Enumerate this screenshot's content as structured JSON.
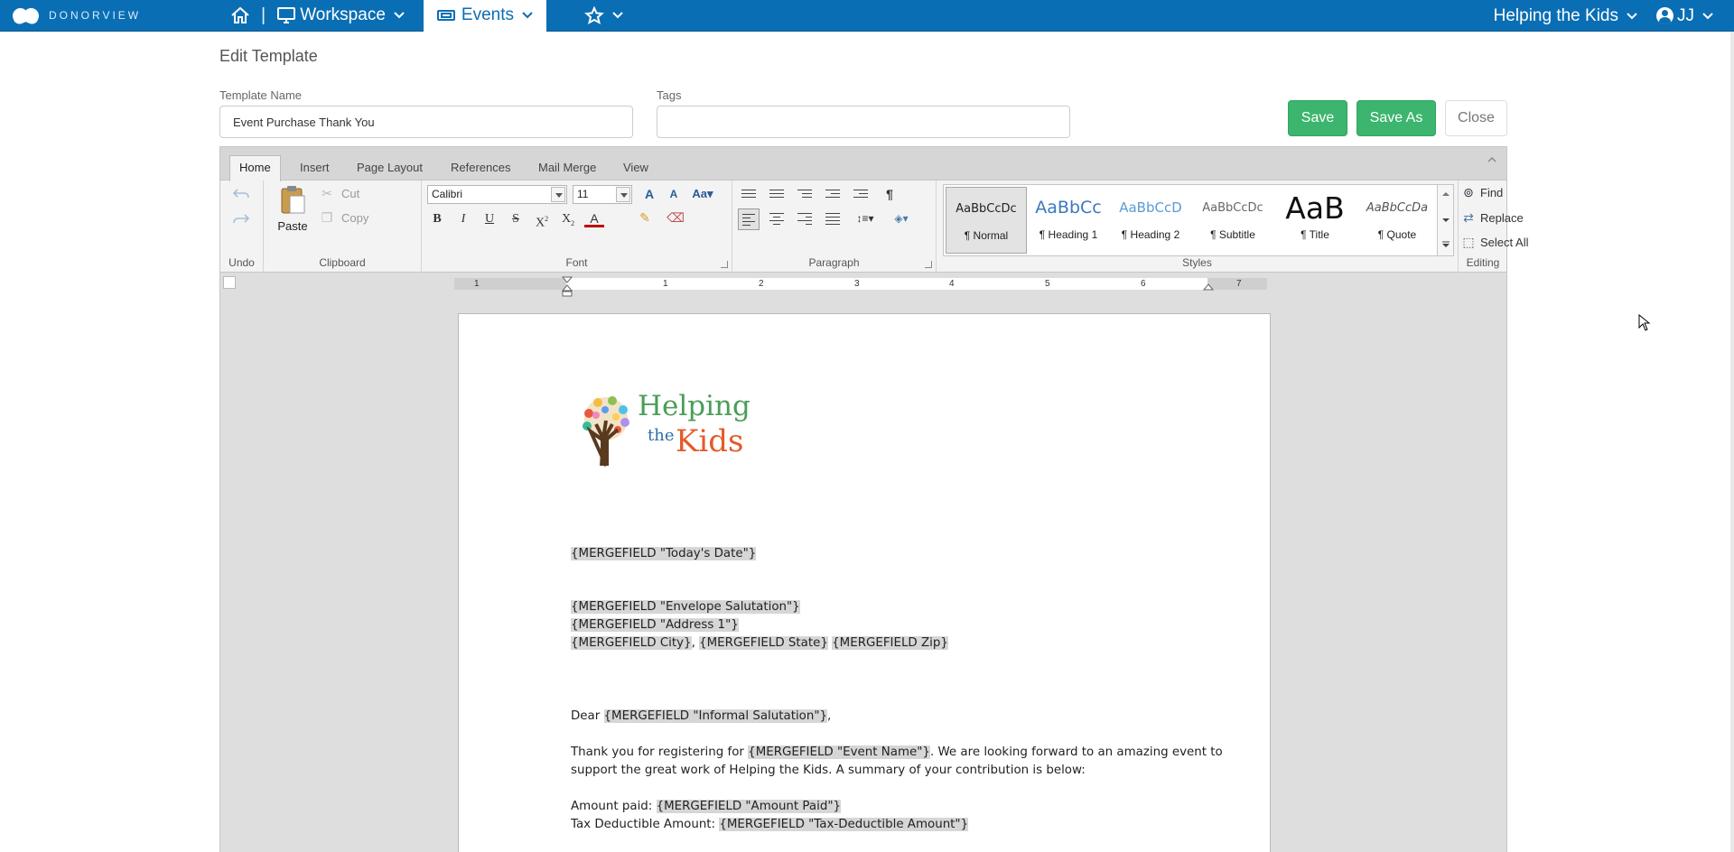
{
  "nav": {
    "brand": "DONORVIEW",
    "workspace": "Workspace",
    "events": "Events",
    "org": "Helping the Kids",
    "user": "JJ"
  },
  "editor": {
    "title": "Edit Template",
    "template_name_label": "Template Name",
    "template_name_value": "Event Purchase Thank You",
    "tags_label": "Tags",
    "tags_value": "",
    "save": "Save",
    "save_as": "Save As",
    "close": "Close"
  },
  "ribbon": {
    "tabs": [
      "Home",
      "Insert",
      "Page Layout",
      "References",
      "Mail Merge",
      "View"
    ],
    "groups": {
      "undo": "Undo",
      "clipboard": "Clipboard",
      "font": "Font",
      "paragraph": "Paragraph",
      "styles": "Styles",
      "editing": "Editing"
    },
    "paste": "Paste",
    "cut": "Cut",
    "copy": "Copy",
    "font_name": "Calibri",
    "font_size": "11",
    "styles": [
      {
        "sample": "AaBbCcDc",
        "name": "¶ Normal"
      },
      {
        "sample": "AaBbCc",
        "name": "¶ Heading 1"
      },
      {
        "sample": "AaBbCcD",
        "name": "¶ Heading 2"
      },
      {
        "sample": "AaBbCcDc",
        "name": "¶ Subtitle"
      },
      {
        "sample": "AaB",
        "name": "¶ Title"
      },
      {
        "sample": "AaBbCcDa",
        "name": "¶ Quote"
      }
    ],
    "find": "Find",
    "replace": "Replace",
    "select_all": "Select All"
  },
  "ruler": [
    "1",
    "1",
    "2",
    "3",
    "4",
    "5",
    "6",
    "7"
  ],
  "document": {
    "logo_helping": "Helping",
    "logo_the": "the",
    "logo_kids": "Kids",
    "date_field": "{MERGEFIELD \"Today's Date\"}",
    "salutation_field": "{MERGEFIELD \"Envelope Salutation\"}",
    "address_field": "{MERGEFIELD \"Address 1\"}",
    "city_field": "{MERGEFIELD City}",
    "comma": ", ",
    "state_field": "{MERGEFIELD State}",
    "zip_field": "{MERGEFIELD Zip}",
    "dear": "Dear ",
    "informal_field": "{MERGEFIELD \"Informal Salutation\"}",
    "dear_end": ",",
    "thanks_start": "Thank you for registering for ",
    "event_field": "{MERGEFIELD \"Event Name\"}",
    "thanks_end": ". We are looking forward to an amazing event to",
    "thanks_line2": "support the great work of Helping the Kids. A summary of your contribution is below:",
    "amount_label": "Amount paid: ",
    "amount_field": "{MERGEFIELD \"Amount Paid\"}",
    "tax_label": "Tax Deductible Amount: ",
    "tax_field": "{MERGEFIELD \"Tax-Deductible Amount\"}"
  }
}
